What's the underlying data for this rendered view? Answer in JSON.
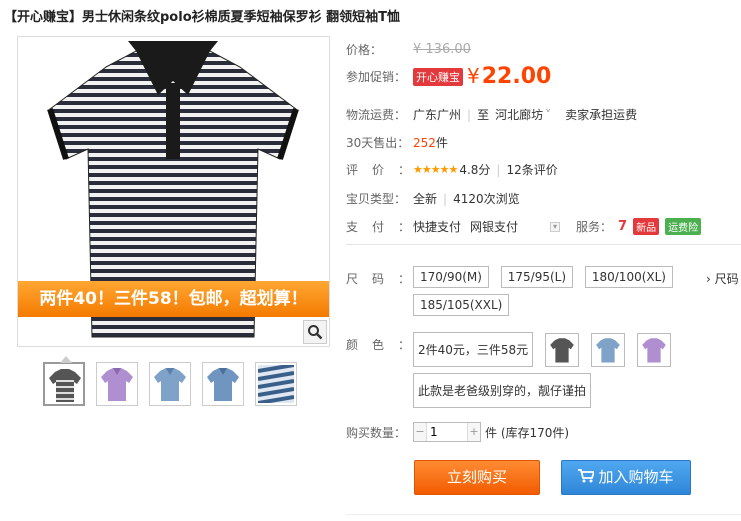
{
  "title": "【开心赚宝】男士休闲条纹polo衫棉质夏季短袖保罗衫 翻领短袖T恤",
  "image": {
    "banner": "两件40！三件58！包邮，超划算！",
    "zoom_icon": "magnifier-icon"
  },
  "thumbnails": [
    {
      "name": "thumb-gray-stripe",
      "color": "#555"
    },
    {
      "name": "thumb-purple",
      "color": "#b08fd0"
    },
    {
      "name": "thumb-blue",
      "color": "#7fa3c8"
    },
    {
      "name": "thumb-blue-2",
      "color": "#6f95c0"
    },
    {
      "name": "thumb-stripe-closeup",
      "color": "#5a7fa8"
    }
  ],
  "price": {
    "label": "价格：",
    "original": "¥ 136.00",
    "promo_label": "参加促销：",
    "promo_tag": "开心赚宝",
    "currency": "¥",
    "current": "22.00"
  },
  "shipping": {
    "label": "物流运费：",
    "from": "广东广州",
    "to_prefix": "至",
    "to": "河北廊坊",
    "carrier": "卖家承担运费"
  },
  "sales": {
    "label": "30天售出：",
    "count": "252",
    "unit": "件"
  },
  "rating": {
    "label": "评价：",
    "stars": "★★★★★",
    "score": "4.8分",
    "reviews": "12条评价"
  },
  "type": {
    "label": "宝贝类型：",
    "condition": "全新",
    "views": "4120次浏览"
  },
  "payment": {
    "label": "支付：",
    "method1": "快捷支付",
    "method2": "网银支付",
    "service_label": "服务：",
    "badge_7": "7",
    "badge_new": "新品",
    "badge_ins": "运费险"
  },
  "size": {
    "label": "尺码：",
    "options": [
      "170/90(M)",
      "175/95(L)",
      "180/100(XL)",
      "185/105(XXL)"
    ],
    "chart_link": "› 尺码"
  },
  "color": {
    "label": "颜色：",
    "option_text": "2件40元，三件58元",
    "swatches": [
      "#555",
      "#7fa3c8",
      "#b08fd0"
    ],
    "note": "此款是老爸级别穿的，靓仔谨拍"
  },
  "quantity": {
    "label": "购买数量：",
    "value": "1",
    "stock": "件 (库存170件)"
  },
  "actions": {
    "buy": "立刻购买",
    "cart": "加入购物车",
    "accent_orange": "#f25b00",
    "accent_blue": "#2f86d8"
  }
}
